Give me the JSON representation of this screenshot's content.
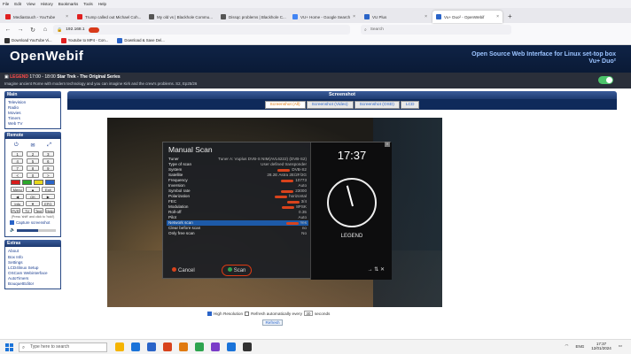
{
  "browser": {
    "menu": [
      "File",
      "Edit",
      "View",
      "History",
      "Bookmarks",
      "Tools",
      "Help"
    ],
    "tabs": [
      {
        "title": "Mediastouch - YouTube",
        "color": "#e02020",
        "active": false
      },
      {
        "title": "Trump called out Michael Coh...",
        "color": "#e02020",
        "active": false
      },
      {
        "title": "My old vs | Blackhole Commu...",
        "color": "#555555",
        "active": false
      },
      {
        "title": "Dissqc problems | Blackhole C...",
        "color": "#555555",
        "active": false
      },
      {
        "title": "VU+ Home - Google Search",
        "color": "#4285f4",
        "active": false
      },
      {
        "title": "VU Plus",
        "color": "#2a64c8",
        "active": false
      },
      {
        "title": "Vu+ Duo² - OpenWebif",
        "color": "#2a64c8",
        "active": true
      }
    ],
    "new_tab": "+",
    "nav": {
      "back": "←",
      "forward": "→",
      "reload": "↻",
      "home": "⌂"
    },
    "url": "192.168.1",
    "search_placeholder": "Search",
    "bookmarks": [
      {
        "label": "Download YouTube Vi...",
        "color": "#333333"
      },
      {
        "label": "Youtube to MP4 - Con...",
        "color": "#e02020"
      },
      {
        "label": "Download & Save Del...",
        "color": "#2a64c8"
      }
    ]
  },
  "owif": {
    "logo": "OpenWebif",
    "tagline1": "Open Source Web Interface for Linux set-top box",
    "tagline2": "Vu+ Duo²",
    "now": {
      "legend": "LEGEND",
      "time": "17:00 - 18:00",
      "title": "Star Trek - The Original Series",
      "description": "Imagine ancient Rome with modern technology and you can imagine Kirk and the crew's problems. S2, Ep25/26"
    }
  },
  "sidebar": {
    "main_title": "Main",
    "main_items": [
      "Television",
      "Radio",
      "Movies",
      "Timers",
      "Web TV"
    ],
    "remote_title": "Remote",
    "keypad": [
      "1",
      "2",
      "3",
      "4",
      "5",
      "6",
      "7",
      "8",
      "9",
      "<",
      "0",
      ">"
    ],
    "colors": [
      "#d81c1c",
      "#2ba82b",
      "#e8d81c",
      "#2a64c8"
    ],
    "rows": [
      [
        "Menu",
        "▲",
        "Exit"
      ],
      [
        "◀",
        "OK",
        "▶"
      ],
      [
        "Info",
        "▼",
        "EPG"
      ],
      [
        "PVR",
        "TV",
        "Text",
        "Help"
      ]
    ],
    "hint": "(Press 'shift' and click to 'hold')",
    "capture_label": "Capture screenshot",
    "volume_fraction": 0.55,
    "extras_title": "Extras",
    "extras_items": [
      "About",
      "Box Info",
      "Settings",
      "LCD4linux Setup",
      "OSCam Webinterface",
      "AutoTimers",
      "BouquetEditor"
    ]
  },
  "screenshot": {
    "title": "Screenshot",
    "tabs": [
      "Screenshot (All)",
      "Screenshot (Video)",
      "Screenshot (OSD)",
      "LCD"
    ],
    "selected_tab": 0,
    "options": {
      "high_res": "High Resolution",
      "refresh_auto": "Refresh automatically every",
      "interval": "30",
      "seconds": "seconds"
    },
    "refresh_button": "Refresh"
  },
  "osd": {
    "title": "Manual Scan",
    "rows": [
      {
        "label": "Tuner",
        "value": "Tuner A: Vuplus DVB-S NIM(AVL6222) (DVB-S2)",
        "redacted": false
      },
      {
        "label": "Type of scan",
        "value": "User defined transponder",
        "redacted": false
      },
      {
        "label": "System",
        "value": "DVB-S2",
        "redacted": true
      },
      {
        "label": "Satellite",
        "value": "28.2E Astra 2E/2F/2G",
        "redacted": false
      },
      {
        "label": "Frequency",
        "value": "10773",
        "redacted": true
      },
      {
        "label": "Inversion",
        "value": "Auto",
        "redacted": false
      },
      {
        "label": "Symbol rate",
        "value": "23000",
        "redacted": true
      },
      {
        "label": "Polarization",
        "value": "horizontal",
        "redacted": true
      },
      {
        "label": "FEC",
        "value": "3/4",
        "redacted": true
      },
      {
        "label": "Modulation",
        "value": "8PSK",
        "redacted": true
      },
      {
        "label": "Roll-off",
        "value": "0.35",
        "redacted": false
      },
      {
        "label": "Pilot",
        "value": "Auto",
        "redacted": false
      },
      {
        "label": "Network scan",
        "value": "Yes",
        "redacted": true,
        "highlight": true
      },
      {
        "label": "Clear before scan",
        "value": "no",
        "redacted": false
      },
      {
        "label": "Only free scan",
        "value": "No",
        "redacted": false
      }
    ],
    "clock": "17:37",
    "legend": "LEGEND",
    "cancel": "Cancel",
    "scan": "Scan"
  },
  "taskbar": {
    "search_placeholder": "Type here to search",
    "apps": [
      "#f5b400",
      "#1a73d9",
      "#2a64c8",
      "#d8431c",
      "#e07a10",
      "#2ea44f",
      "#7a3cc8",
      "#1a73d9",
      "#333333"
    ],
    "lang": "ENG",
    "time": "17:37",
    "date": "12/01/2024"
  }
}
